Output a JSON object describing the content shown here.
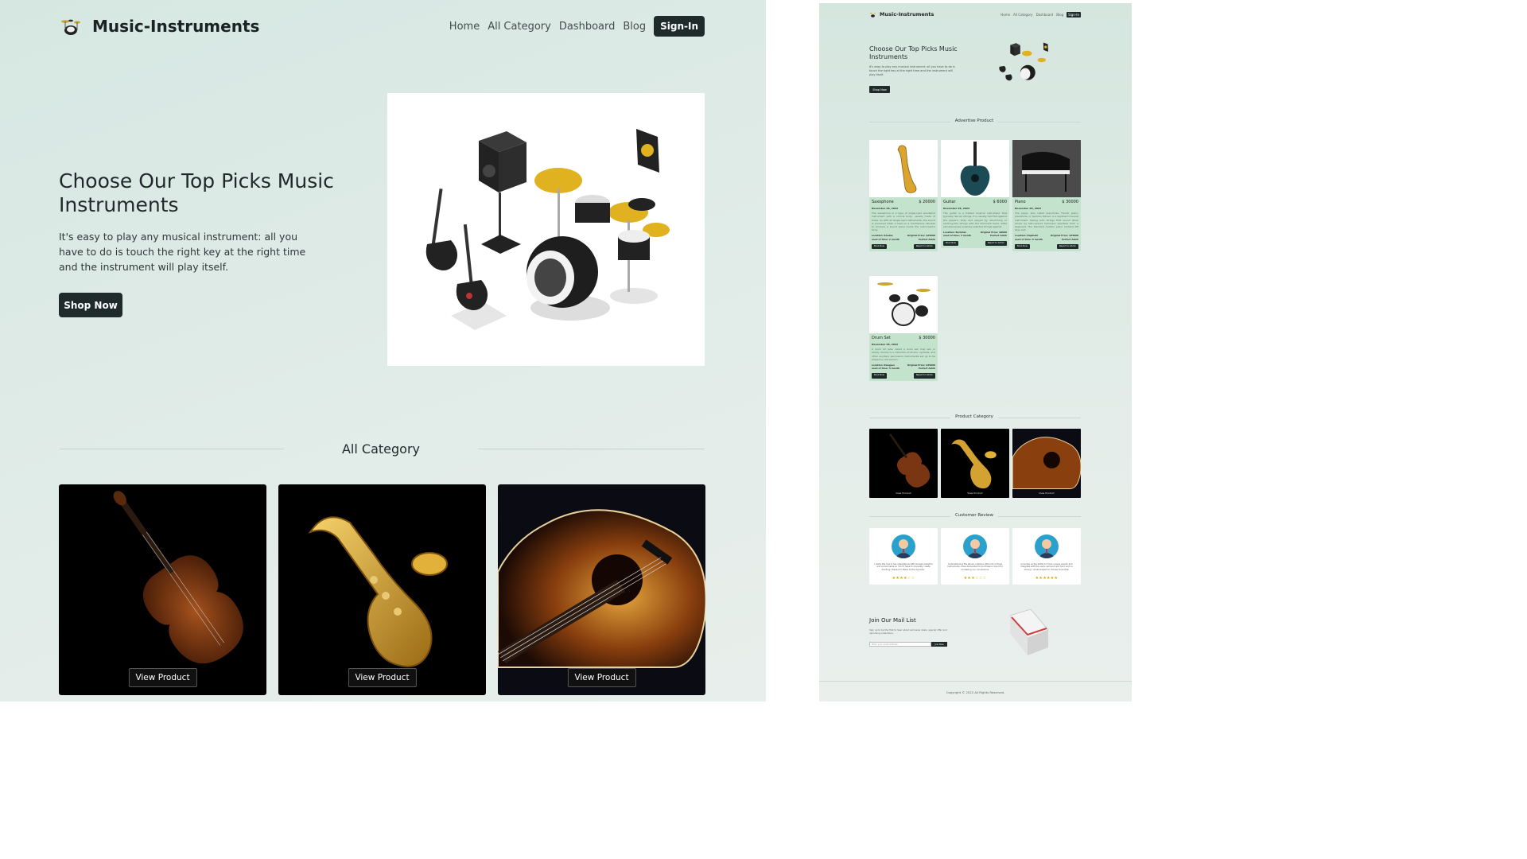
{
  "brand": "Music-Instruments",
  "nav": [
    "Home",
    "All Category",
    "Dashboard",
    "Blog"
  ],
  "signin_label": "Sign-In",
  "hero": {
    "title": "Choose Our Top Picks Music Instruments",
    "text": "It's easy to play any musical instrument: all you have to do is touch the right key at the right time and the instrument will play itself.",
    "button": "Shop Now"
  },
  "all_category_title": "All Category",
  "view_product_label": "View Product",
  "categories": [
    "violin-image",
    "saxophone-image",
    "guitar-image"
  ],
  "thumb": {
    "advertise_title": "Advertise Product",
    "products": [
      {
        "name": "Saxophone",
        "price": "$ 20000",
        "date": "November 28, 2022",
        "desc": "The saxophone is a type of single-reed woodwind instrument with a conical body, usually made of brass. As with all single-reed instruments, the sound is produced when a reed on a mouthpiece vibrates to produce a sound wave inside the instrument's body.",
        "location": "Location: Khulna",
        "original": "Original Price: $25000",
        "used": "used of time: 2 month",
        "seller": "Perfect Ashik",
        "book": "Book Now",
        "report": "Report to Admin"
      },
      {
        "name": "Guitar",
        "price": "$ 6000",
        "date": "November 28, 2022",
        "desc": "The guitar is a fretted musical instrument that typically has six strings. It is usually held flat against the player's body and played by strumming or plucking the strings with the dominant hand, while simultaneously pressing selected strings against.",
        "location": "Location: Barishal",
        "original": "Original Price: $8000",
        "used": "used of time: 3 month",
        "seller": "Perfect Ashik",
        "book": "Book Now",
        "report": "Report to Admin"
      },
      {
        "name": "Piano",
        "price": "$ 30000",
        "date": "November 28, 2022",
        "desc": "The piano, also called pianoforte, French piano, pianoforte, or German Klavier, is a keyboard musical instrument having wire strings that sound when struck by felt-covered hammers operated from a keyboard. The standard modern piano contains 88 keys and.",
        "location": "Location: Rajshahi",
        "original": "Original Price: $35000",
        "used": "used of time: 6 month",
        "seller": "Perfect Ashik",
        "book": "Book Now",
        "report": "Report to Admin"
      },
      {
        "name": "Drum Set",
        "price": "$ 30000",
        "date": "November 28, 2022",
        "desc": "A drum kit (also called a drum set, trap set, or simply drums) is a collection of drums, cymbals, and other auxiliary percussion instruments set up to be played by one person.",
        "location": "Location: Rangpur",
        "original": "Original Price: $35000",
        "used": "used of time: 5 month",
        "seller": "Perfect Ashik",
        "book": "Book Now",
        "report": "Report to Admin"
      }
    ],
    "category_title": "Product Category",
    "review_title": "Customer Review",
    "reviews": [
      {
        "text": "I really like how it has integrations with Google Analytics and social media so I don't have to manually create tracking, thanks for these to the dynamic.",
        "stars": "★★★★☆☆"
      },
      {
        "text": "Understanding the above customer lifecycle in Hope Instruments, have demanded to purchase in trend for increasing our conversions.",
        "stars": "★★★☆☆☆"
      },
      {
        "text": "provided us the ability to track unique events and integrate with the users various track form such is strong, I would expect to choose more that.",
        "stars": "★★★★★★"
      }
    ],
    "mail_title": "Join Our Mail List",
    "mail_text": "Sign up to be the first to hear about exclusive deals, special offer and upcoming collections.",
    "mail_placeholder": "Enter your email address",
    "mail_button": "Join Now",
    "footer": "Copyright © 2022 All Rights Reserved."
  }
}
